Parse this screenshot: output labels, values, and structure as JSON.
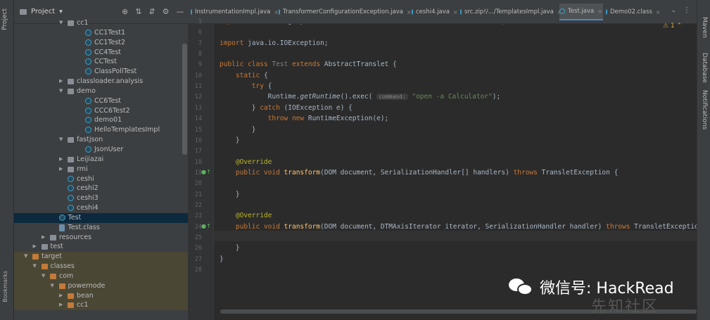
{
  "left_stripe": {
    "project_tab": "Project",
    "bookmarks_tab": "Bookmarks"
  },
  "right_stripe": {
    "maven": "Maven",
    "database": "Database",
    "notifications": "Notifications"
  },
  "project_panel": {
    "title": "Project"
  },
  "tree": [
    {
      "label": "cc1",
      "depth": 4,
      "kind": "folder",
      "arrow": "down"
    },
    {
      "label": "CC1Test1",
      "depth": 6,
      "kind": "class"
    },
    {
      "label": "CC1Test2",
      "depth": 6,
      "kind": "class"
    },
    {
      "label": "CC4Test",
      "depth": 6,
      "kind": "class"
    },
    {
      "label": "CCTest",
      "depth": 6,
      "kind": "class"
    },
    {
      "label": "ClassPollTest",
      "depth": 6,
      "kind": "class"
    },
    {
      "label": "classloader.analysis",
      "depth": 4,
      "kind": "folder",
      "arrow": "right"
    },
    {
      "label": "demo",
      "depth": 4,
      "kind": "folder",
      "arrow": "down"
    },
    {
      "label": "CC6Test",
      "depth": 6,
      "kind": "class"
    },
    {
      "label": "CCC6Test2",
      "depth": 6,
      "kind": "class"
    },
    {
      "label": "demo01",
      "depth": 6,
      "kind": "class"
    },
    {
      "label": "HelloTemplatesImpl",
      "depth": 6,
      "kind": "class"
    },
    {
      "label": "fastjson",
      "depth": 4,
      "kind": "folder",
      "arrow": "down"
    },
    {
      "label": "JsonUser",
      "depth": 6,
      "kind": "class"
    },
    {
      "label": "Leijiazai",
      "depth": 4,
      "kind": "folder",
      "arrow": "right"
    },
    {
      "label": "rmi",
      "depth": 4,
      "kind": "folder",
      "arrow": "right"
    },
    {
      "label": "ceshi",
      "depth": 4,
      "kind": "class"
    },
    {
      "label": "ceshi2",
      "depth": 4,
      "kind": "class"
    },
    {
      "label": "ceshi3",
      "depth": 4,
      "kind": "class"
    },
    {
      "label": "ceshi4",
      "depth": 4,
      "kind": "class"
    },
    {
      "label": "Test",
      "depth": 3,
      "kind": "class",
      "selected": true
    },
    {
      "label": "Test.class",
      "depth": 3,
      "kind": "cfile"
    },
    {
      "label": "resources",
      "depth": 2,
      "kind": "folder",
      "arrow": "right"
    },
    {
      "label": "test",
      "depth": 1,
      "kind": "folder",
      "arrow": "right"
    },
    {
      "label": "target",
      "depth": 0,
      "kind": "folder-orange",
      "arrow": "down",
      "target": true
    },
    {
      "label": "classes",
      "depth": 1,
      "kind": "folder-orange",
      "arrow": "down",
      "target": true
    },
    {
      "label": "com",
      "depth": 2,
      "kind": "folder-orange",
      "arrow": "down",
      "target": true
    },
    {
      "label": "powernode",
      "depth": 3,
      "kind": "folder-orange",
      "arrow": "down",
      "target": true
    },
    {
      "label": "bean",
      "depth": 4,
      "kind": "folder-orange",
      "arrow": "right",
      "target": true
    },
    {
      "label": "cc1",
      "depth": 4,
      "kind": "folder-orange",
      "arrow": "right",
      "target": true
    }
  ],
  "tabs": [
    {
      "label": "InstrumentationImpl.java"
    },
    {
      "label": "TransformerConfigurationException.java"
    },
    {
      "label": "ceshi4.java"
    },
    {
      "label": "src.zip!/.../TemplatesImpl.java"
    },
    {
      "label": "Test.java",
      "active": true
    },
    {
      "label": "Demo02.class"
    }
  ],
  "editor": {
    "warning_count": "1",
    "lines": [
      {
        "n": "5",
        "html": "<span class='kw'>import</span> com.sun.org.apache.xml.internal.serializer.SerializationHandler;"
      },
      {
        "n": "6",
        "html": ""
      },
      {
        "n": "7",
        "html": "<span class='kw'>import</span> java.io.IOException;"
      },
      {
        "n": "8",
        "html": ""
      },
      {
        "n": "9",
        "html": "<span class='kw'>public class</span> <span class='gray'>Test</span> <span class='kw'>extends</span> AbstractTranslet {"
      },
      {
        "n": "10",
        "html": "    <span class='kw'>static</span> {"
      },
      {
        "n": "11",
        "html": "        <span class='kw'>try</span> {"
      },
      {
        "n": "12",
        "html": "            Runtime.<span class='it'>getRuntime</span>().exec( <span class='hint'>command:</span> <span class='str'>\"open -a Calculator\"</span>);"
      },
      {
        "n": "13",
        "html": "        } <span class='kw'>catch</span> (IOException e) {"
      },
      {
        "n": "14",
        "html": "            <span class='kw'>throw new</span> RuntimeException(e);"
      },
      {
        "n": "15",
        "html": "        }"
      },
      {
        "n": "16",
        "html": "    }"
      },
      {
        "n": "17",
        "html": ""
      },
      {
        "n": "18",
        "html": "    <span class='ann'>@Override</span>"
      },
      {
        "n": "19",
        "html": "    <span class='kw'>public void</span> <span class='fn'>transform</span>(DOM document, SerializationHandler[] handlers) <span class='kw'>throws</span> TransletException {"
      },
      {
        "n": "20",
        "html": ""
      },
      {
        "n": "21",
        "html": "    }"
      },
      {
        "n": "22",
        "html": ""
      },
      {
        "n": "23",
        "html": "    <span class='ann'>@Override</span>"
      },
      {
        "n": "24",
        "html": "    <span class='kw'>public void</span> <span class='fn'>transform</span>(DOM document, DTMAxisIterator iterator, SerializationHandler handler) <span class='kw'>throws</span> TransletException {"
      },
      {
        "n": "25",
        "html": ""
      },
      {
        "n": "26",
        "html": "    }"
      },
      {
        "n": "27",
        "html": "}"
      },
      {
        "n": "28",
        "html": ""
      }
    ]
  },
  "watermark": {
    "text": "微信号: HackRead",
    "site": "先知社区"
  }
}
